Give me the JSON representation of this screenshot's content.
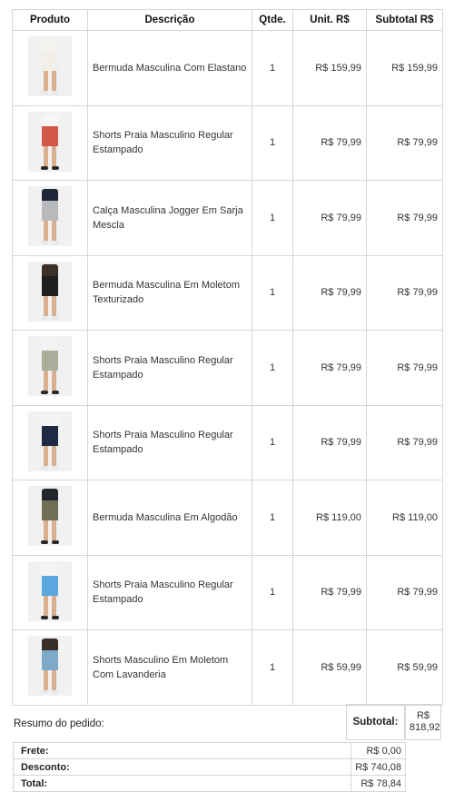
{
  "headers": {
    "product": "Produto",
    "description": "Descrição",
    "qty": "Qtde.",
    "unit": "Unit. R$",
    "subtotal": "Subtotal R$"
  },
  "items": [
    {
      "description": "Bermuda Masculina Com Elastano",
      "qty": "1",
      "unit": "R$ 159,99",
      "subtotal": "R$ 159,99",
      "top": "#f4f2ec",
      "bottom": "#f1efe8",
      "shoe": "#e8e8e8"
    },
    {
      "description": "Shorts Praia Masculino Regular Estampado",
      "qty": "1",
      "unit": "R$ 79,99",
      "subtotal": "R$ 79,99",
      "top": "#f6f6f6",
      "bottom": "#d2584a",
      "shoe": "#2a2a2a"
    },
    {
      "description": "Calça Masculina Jogger Em Sarja Mescla",
      "qty": "1",
      "unit": "R$ 79,99",
      "subtotal": "R$ 79,99",
      "top": "#1e2638",
      "bottom": "#b7b9bb",
      "shoe": "#e8e8e8"
    },
    {
      "description": "Bermuda Masculina Em Moletom Texturizado",
      "qty": "1",
      "unit": "R$ 79,99",
      "subtotal": "R$ 79,99",
      "top": "#3b3028",
      "bottom": "#1f1f1f",
      "shoe": "#e8e8e8"
    },
    {
      "description": "Shorts Praia Masculino Regular Estampado",
      "qty": "1",
      "unit": "R$ 79,99",
      "subtotal": "R$ 79,99",
      "top": "#f3f3f3",
      "bottom": "#a9ad9a",
      "shoe": "#2a2a2a"
    },
    {
      "description": "Shorts Praia Masculino Regular Estampado",
      "qty": "1",
      "unit": "R$ 79,99",
      "subtotal": "R$ 79,99",
      "top": "#f4f4f4",
      "bottom": "#1f2a44",
      "shoe": "#e8e8e8"
    },
    {
      "description": "Bermuda Masculina Em Algodão",
      "qty": "1",
      "unit": "R$ 119,00",
      "subtotal": "R$ 119,00",
      "top": "#23262d",
      "bottom": "#6f6f55",
      "shoe": "#2a2a2a"
    },
    {
      "description": "Shorts Praia Masculino Regular Estampado",
      "qty": "1",
      "unit": "R$ 79,99",
      "subtotal": "R$ 79,99",
      "top": "#f4f4f4",
      "bottom": "#5aa6df",
      "shoe": "#2a2a2a"
    },
    {
      "description": "Shorts Masculino Em Moletom Com Lavanderia",
      "qty": "1",
      "unit": "R$ 59,99",
      "subtotal": "R$ 59,99",
      "top": "#3a2f28",
      "bottom": "#7fa9c8",
      "shoe": "#e8e8e8"
    }
  ],
  "summary": {
    "title": "Resumo do pedido:",
    "subtotal_label": "Subtotal:",
    "subtotal_value": "R$ 818,92",
    "rows": [
      {
        "label": "Frete:",
        "value": "R$ 0,00"
      },
      {
        "label": "Desconto:",
        "value": "R$ 740,08"
      },
      {
        "label": "Total:",
        "value": "R$ 78,84"
      }
    ]
  }
}
